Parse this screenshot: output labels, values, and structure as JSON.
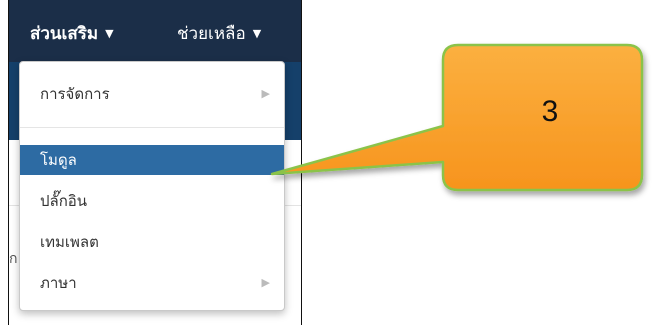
{
  "navbar": {
    "extensions_label": "ส่วนเสริม",
    "help_label": "ช่วยเหลือ"
  },
  "dropdown": {
    "items": [
      {
        "label": "การจัดการ",
        "has_submenu": true
      },
      {
        "label": "โมดูล",
        "selected": true
      },
      {
        "label": "ปลั๊กอิน"
      },
      {
        "label": "เทมเพลต"
      },
      {
        "label": "ภาษา",
        "has_submenu": true
      }
    ]
  },
  "side_text": "ก",
  "callout": {
    "number": "3"
  },
  "colors": {
    "navbar": "#1b2e48",
    "selected": "#2d6ba3",
    "callout_fill": "#f7941d",
    "callout_border": "#8bc34a"
  }
}
